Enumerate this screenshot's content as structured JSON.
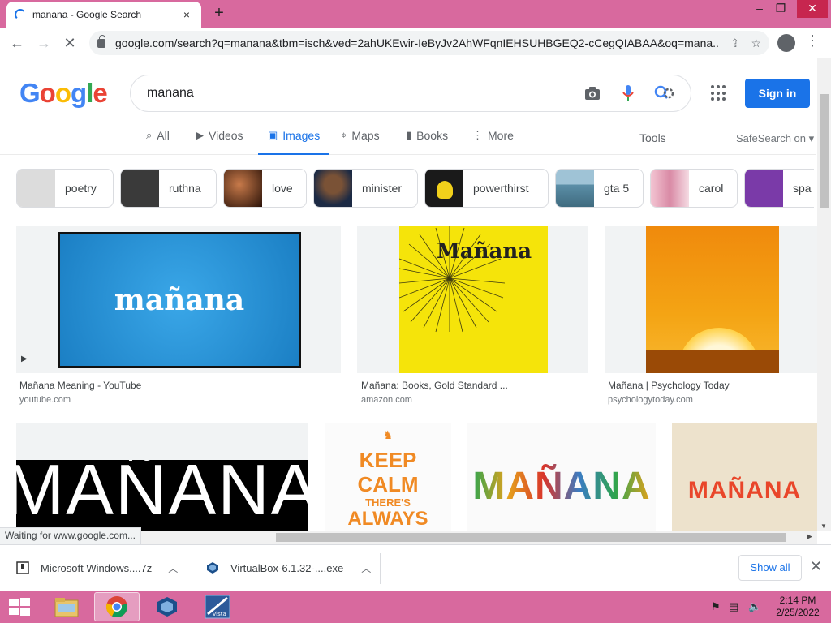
{
  "browser": {
    "tab_title": "manana - Google Search",
    "tab_close": "×",
    "new_tab": "+",
    "window_controls": [
      "–",
      "❐",
      "✕"
    ],
    "url": "google.com/search?q=manana&tbm=isch&ved=2ahUKEwir-IeByJv2AhWFqnIEHSUHBGEQ2-cCegQIABAA&oq=mana...",
    "back": "←",
    "forward": "→",
    "stop": "✕",
    "status_text": "Waiting for www.google.com..."
  },
  "google": {
    "logo_letters": [
      "G",
      "o",
      "o",
      "g",
      "l",
      "e"
    ],
    "query": "manana",
    "sign_in": "Sign in",
    "tabs": [
      {
        "label": "All",
        "icon": "search-icon"
      },
      {
        "label": "Videos",
        "icon": "video-icon"
      },
      {
        "label": "Images",
        "icon": "image-icon"
      },
      {
        "label": "Maps",
        "icon": "map-pin-icon"
      },
      {
        "label": "Books",
        "icon": "book-icon"
      },
      {
        "label": "More",
        "icon": "more-vert-icon"
      }
    ],
    "tools": "Tools",
    "safesearch": "SafeSearch on ▾"
  },
  "chips": [
    {
      "label": "poetry",
      "color": "#dcdcdc"
    },
    {
      "label": "ruthna",
      "color": "#3a3a3a"
    },
    {
      "label": "love",
      "color": "#5a2a1a"
    },
    {
      "label": "minister",
      "color": "#6b4a2e"
    },
    {
      "label": "powerthirst",
      "color": "#1a1a1a"
    },
    {
      "label": "gta 5",
      "color": "#6f9fb5"
    },
    {
      "label": "carol",
      "color": "#e6b0c0"
    },
    {
      "label": "spa",
      "color": "#7a3aa8"
    }
  ],
  "results": [
    {
      "title": "Mañana Meaning - YouTube",
      "site": "youtube.com",
      "caption": "mañana"
    },
    {
      "title": "Mañana: Books, Gold Standard ...",
      "site": "amazon.com",
      "caption": "Mañana"
    },
    {
      "title": "Mañana | Psychology Today",
      "site": "psychologytoday.com"
    }
  ],
  "row2": {
    "big_text": "MAÑANA",
    "keepcalm_lines": [
      "KEEP",
      "CALM",
      "THERE'S",
      "ALWAYS"
    ],
    "colorful_text": "MAÑANA",
    "orange_text": "MAÑANA"
  },
  "downloads": [
    {
      "name": "Microsoft Windows....7z"
    },
    {
      "name": "VirtualBox-6.1.32-....exe"
    }
  ],
  "show_all": "Show all",
  "taskbar": {
    "time": "2:14 PM",
    "date": "2/25/2022"
  },
  "colors": {
    "titlebar": "#d8699e",
    "accent": "#1a73e8"
  }
}
